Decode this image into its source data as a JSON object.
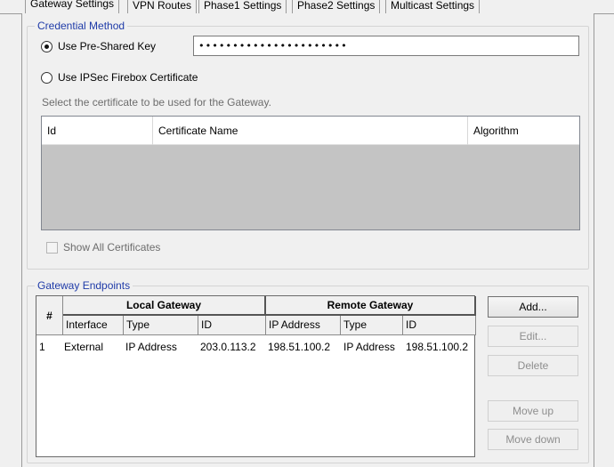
{
  "tabs": [
    {
      "label": "Gateway Settings",
      "active": true
    },
    {
      "label": "VPN Routes",
      "active": false
    },
    {
      "label": "Phase1 Settings",
      "active": false
    },
    {
      "label": "Phase2 Settings",
      "active": false
    },
    {
      "label": "Multicast Settings",
      "active": false
    }
  ],
  "credential": {
    "title": "Credential Method",
    "psk_label": "Use Pre-Shared Key",
    "psk_value": "••••••••••••••••••••••",
    "cert_label": "Use IPSec Firebox Certificate",
    "hint": "Select the certificate to be used for the Gateway.",
    "columns": [
      "Id",
      "Certificate Name",
      "Algorithm"
    ],
    "show_all_label": "Show All Certificates"
  },
  "endpoints": {
    "title": "Gateway Endpoints",
    "num_header": "#",
    "local_header": "Local Gateway",
    "remote_header": "Remote Gateway",
    "columns": [
      "Interface",
      "Type",
      "ID",
      "IP Address",
      "Type",
      "ID"
    ],
    "rows": [
      [
        "1",
        "External",
        "IP Address",
        "203.0.113.2",
        "198.51.100.2",
        "IP Address",
        "198.51.100.2"
      ]
    ]
  },
  "buttons": {
    "add": "Add...",
    "edit": "Edit...",
    "delete": "Delete",
    "move_up": "Move up",
    "move_down": "Move down"
  }
}
